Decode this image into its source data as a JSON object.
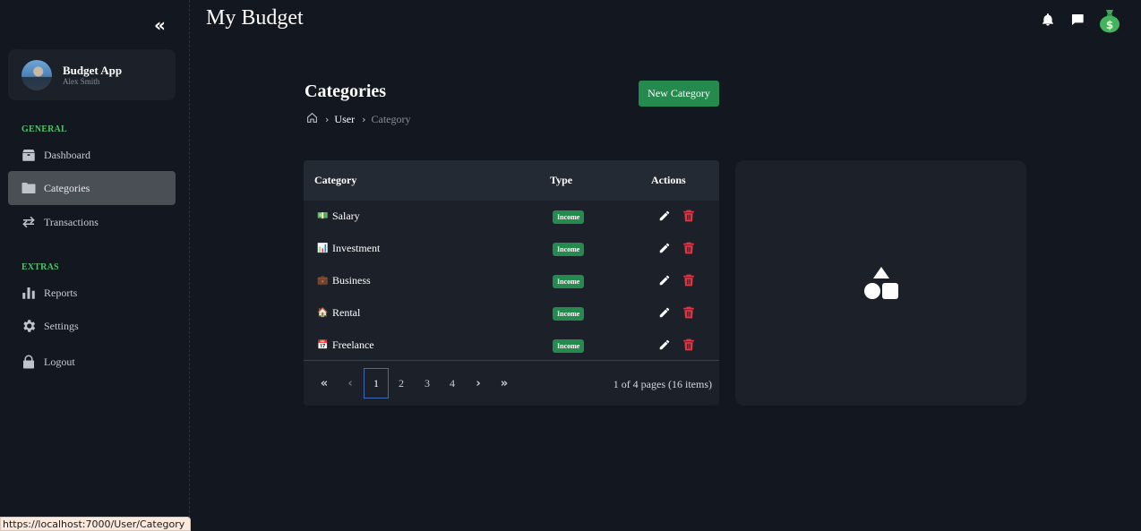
{
  "app": {
    "title": "My Budget"
  },
  "sidebar": {
    "collapse_icon": "double-chevron-left-icon",
    "user": {
      "name": "Budget App",
      "subtitle": "Alex Smith"
    },
    "sections": [
      {
        "label": "GENERAL"
      },
      {
        "label": "EXTRAS"
      }
    ],
    "items": [
      {
        "label": "Dashboard",
        "icon": "box-icon"
      },
      {
        "label": "Categories",
        "icon": "folder-icon",
        "active": true
      },
      {
        "label": "Transactions",
        "icon": "arrows-exchange-icon"
      },
      {
        "label": "Reports",
        "icon": "bar-chart-icon"
      },
      {
        "label": "Settings",
        "icon": "gear-icon"
      },
      {
        "label": "Logout",
        "icon": "lock-icon"
      }
    ]
  },
  "topbar": {
    "icons": [
      "bell-icon",
      "chat-icon",
      "money-bag-icon"
    ]
  },
  "page": {
    "title": "Categories",
    "new_button": "New Category",
    "breadcrumb": [
      "User",
      "Category"
    ]
  },
  "table": {
    "headers": {
      "category": "Category",
      "type": "Type",
      "actions": "Actions"
    },
    "rows": [
      {
        "icon": "💵",
        "name": "Salary",
        "type": "Income"
      },
      {
        "icon": "📊",
        "name": "Investment",
        "type": "Income"
      },
      {
        "icon": "💼",
        "name": "Business",
        "type": "Income"
      },
      {
        "icon": "🏠",
        "name": "Rental",
        "type": "Income"
      },
      {
        "icon": "📅",
        "name": "Freelance",
        "type": "Income"
      }
    ],
    "pagination": {
      "first": "«",
      "prev": "‹",
      "pages": [
        "1",
        "2",
        "3",
        "4"
      ],
      "current_page": 1,
      "next": "›",
      "last": "»",
      "info": "1 of 4 pages (16 items)"
    }
  },
  "colors": {
    "accent_green": "#248a4d",
    "section_label": "#4ec26a",
    "delete_red": "#dc3545",
    "background": "#13171f",
    "card": "#1b2029"
  },
  "status_bar": {
    "url": "https://localhost:7000/User/Category"
  }
}
